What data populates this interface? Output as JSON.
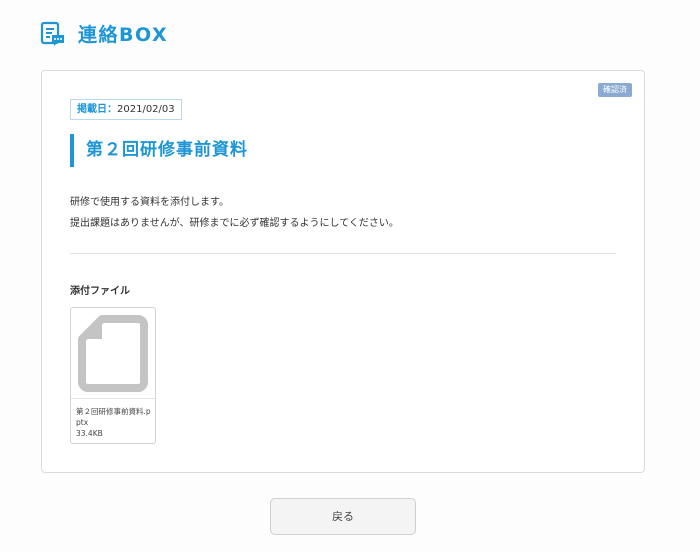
{
  "header": {
    "title": "連絡BOX",
    "icon": "memo-chat-icon"
  },
  "notice": {
    "status_badge": "確認済",
    "date_label": "掲載日：",
    "date_value": "2021/02/03",
    "title": "第２回研修事前資料",
    "body_lines": [
      "研修で使用する資料を添付します。",
      "提出課題はありませんが、研修までに必ず確認するようにしてください。"
    ]
  },
  "attachments": {
    "heading": "添付ファイル",
    "files": [
      {
        "name": "第２回研修事前資料.pptx",
        "size": "33.4KB",
        "icon": "file-icon"
      }
    ]
  },
  "actions": {
    "back_label": "戻る"
  },
  "colors": {
    "accent": "#1e96d6",
    "badge": "#8aaad0"
  }
}
